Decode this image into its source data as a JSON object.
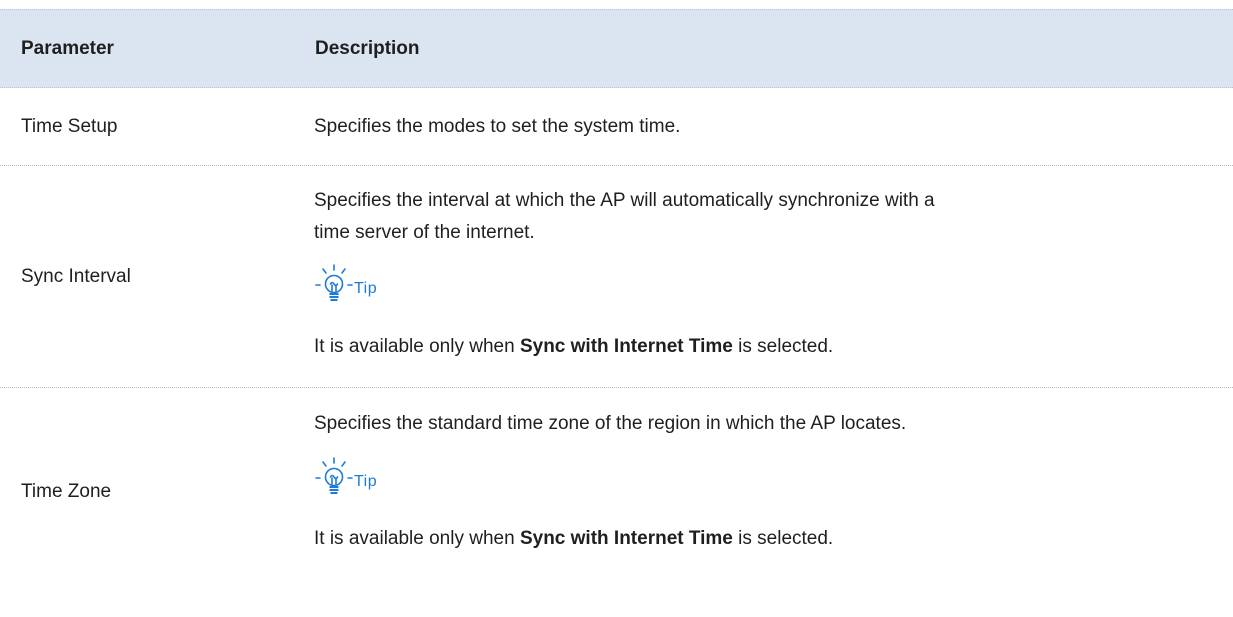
{
  "table": {
    "header": {
      "parameter": "Parameter",
      "description": "Description"
    },
    "rows": [
      {
        "parameter": "Time Setup",
        "description": "Specifies the modes to set the system time."
      },
      {
        "parameter": "Sync Interval",
        "description_line1": "Specifies the interval at which the AP will automatically synchronize with a",
        "description_line2": "time server of the internet.",
        "tip_label": "Tip",
        "note_prefix": "It is available only when ",
        "note_bold": "Sync with Internet Time",
        "note_suffix": " is selected."
      },
      {
        "parameter": "Time Zone",
        "description": "Specifies the standard time zone of the region in which the AP locates.",
        "tip_label": "Tip",
        "note_prefix": "It is available only when ",
        "note_bold": "Sync with Internet Time",
        "note_suffix": " is selected."
      }
    ]
  },
  "icons": {
    "tip": "lightbulb-icon"
  },
  "colors": {
    "header_background": "#dbe5f1",
    "tip_accent": "#1e7bd6",
    "text": "#1f1f1f"
  }
}
